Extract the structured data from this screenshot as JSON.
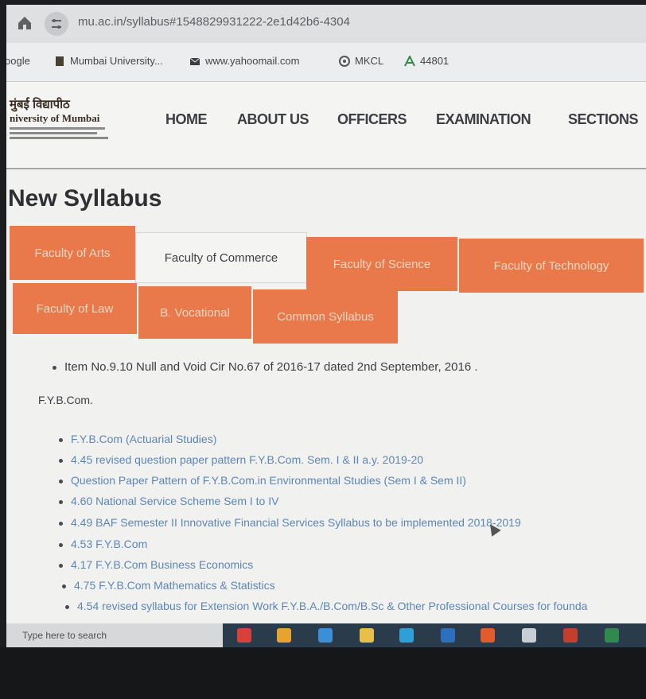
{
  "browser": {
    "url": "mu.ac.in/syllabus#1548829931222-2e1d42b6-4304"
  },
  "bookmarks": [
    {
      "label": "oogle",
      "icon": "google-icon"
    },
    {
      "label": "Mumbai University...",
      "icon": "university-icon"
    },
    {
      "label": "www.yahoomail.com",
      "icon": "mail-icon"
    },
    {
      "label": "MKCL",
      "icon": "mkcl-icon"
    },
    {
      "label": "44801",
      "icon": "a-icon"
    }
  ],
  "site": {
    "logo_line1": "मुंबई विद्यापीठ",
    "logo_line2": "niversity of Mumbai",
    "nav": [
      "HOME",
      "ABOUT US",
      "OFFICERS",
      "EXAMINATION",
      "SECTIONS"
    ]
  },
  "page": {
    "title": "New Syllabus",
    "tabs_row1": [
      {
        "label": "Faculty of Arts",
        "active": false
      },
      {
        "label": "Faculty of Commerce",
        "active": true
      },
      {
        "label": "Faculty of Science",
        "active": false
      },
      {
        "label": "Faculty of Technology",
        "active": false
      }
    ],
    "tabs_row2": [
      {
        "label": "Faculty of Law",
        "active": false
      },
      {
        "label": "B. Vocational",
        "active": false
      },
      {
        "label": "Common Syllabus",
        "active": false
      }
    ],
    "notice": "Item No.9.10 Null and Void Cir No.67 of 2016-17 dated 2nd September, 2016 .",
    "section_label": "F.Y.B.Com.",
    "items": [
      "F.Y.B.Com (Actuarial Studies)",
      "4.45 revised question paper pattern F.Y.B.Com. Sem. I & II a.y. 2019-20",
      "Question Paper Pattern of F.Y.B.Com.in Environmental Studies (Sem I & Sem II)",
      "4.60 National Service Scheme Sem I to IV",
      "4.49 BAF Semester II Innovative Financial Services Syllabus to be implemented 2018-2019",
      "4.53 F.Y.B.Com",
      "4.17 F.Y.B.Com Business Economics",
      "4.75 F.Y.B.Com Mathematics & Statistics",
      "4.54 revised syllabus for Extension Work F.Y.B.A./B.Com/B.Sc & Other Professional Courses for founda"
    ]
  },
  "taskbar": {
    "search_placeholder": "Type here to search"
  },
  "colors": {
    "tab_orange": "#e9794a",
    "link_blue": "#5d86b6"
  }
}
